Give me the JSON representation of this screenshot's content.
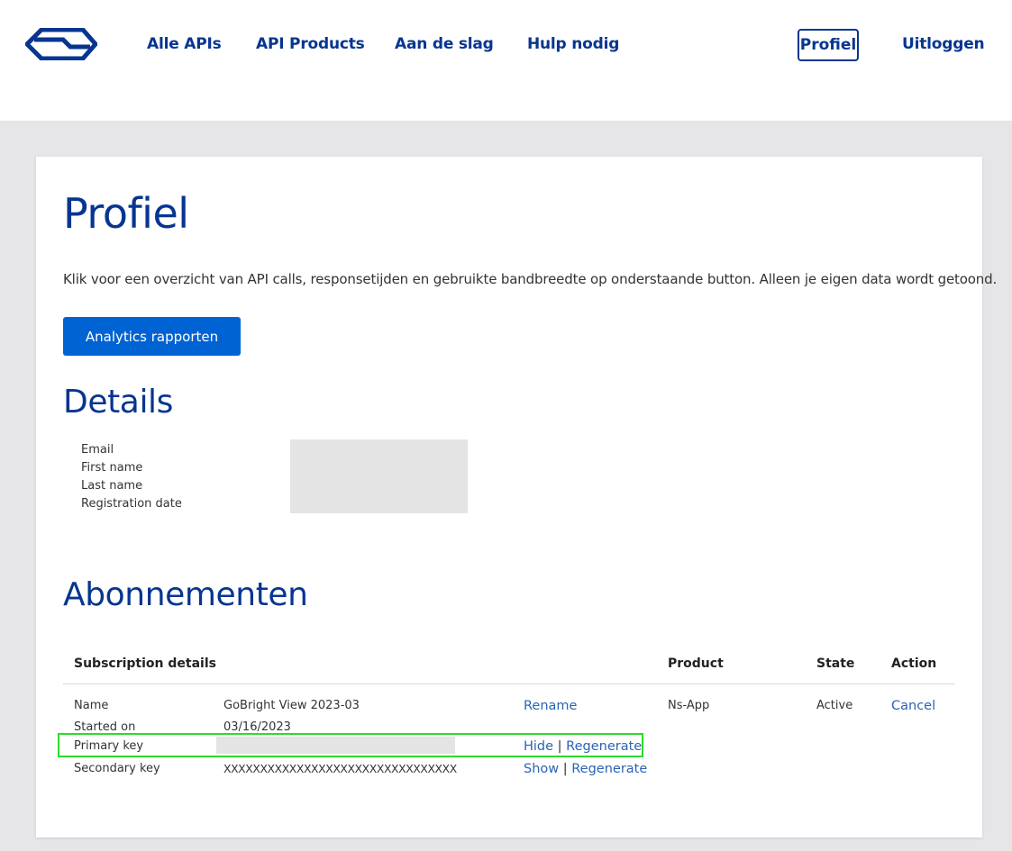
{
  "nav": {
    "items": [
      "Alle APIs",
      "API Products",
      "Aan de slag",
      "Hulp nodig"
    ],
    "profiel": "Profiel",
    "logout": "Uitloggen"
  },
  "page": {
    "title": "Profiel",
    "intro": "Klik voor een overzicht van API calls, responsetijden en gebruikte bandbreedte op onderstaande button. Alleen je eigen data wordt getoond.",
    "analytics_button": "Analytics rapporten"
  },
  "details": {
    "heading": "Details",
    "labels": [
      "Email",
      "First name",
      "Last name",
      "Registration date"
    ]
  },
  "subscriptions": {
    "heading": "Abonnementen",
    "columns": {
      "details": "Subscription details",
      "product": "Product",
      "state": "State",
      "action": "Action"
    },
    "row": {
      "name_label": "Name",
      "name_value": "GoBright View 2023-03",
      "rename": "Rename",
      "started_label": "Started on",
      "started_value": "03/16/2023",
      "primary_label": "Primary key",
      "primary_hide": "Hide",
      "primary_regenerate": "Regenerate",
      "secondary_label": "Secondary key",
      "secondary_value": "XXXXXXXXXXXXXXXXXXXXXXXXXXXXXXXX",
      "secondary_show": "Show",
      "secondary_regenerate": "Regenerate",
      "separator": "|",
      "product": "Ns-App",
      "state": "Active",
      "action": "Cancel"
    }
  },
  "colors": {
    "brand_blue": "#073590",
    "button_blue": "#0063d3",
    "link_blue": "#2a64b4",
    "highlight_green": "#2bdc2b"
  }
}
